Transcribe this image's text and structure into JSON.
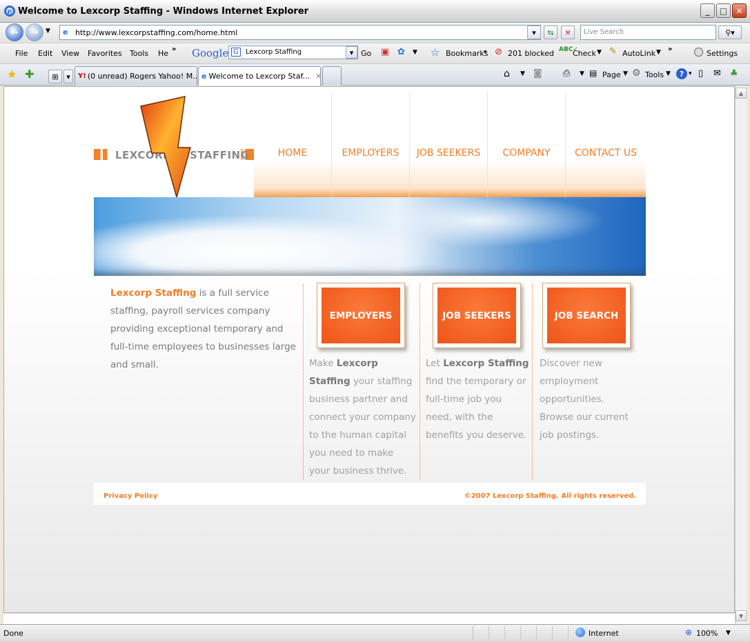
{
  "window": {
    "title": "Welcome to Lexcorp Staffing - Windows Internet Explorer"
  },
  "address": {
    "url": "http://www.lexcorpstaffing.com/home.html",
    "search_placeholder": "Live Search"
  },
  "menu": {
    "items": [
      "File",
      "Edit",
      "View",
      "Favorites",
      "Tools",
      "He"
    ],
    "google_label": "Google",
    "google_query": "Lexcorp Staffing",
    "go_label": "Go",
    "bookmarks": "Bookmarks",
    "blocked": "201 blocked",
    "check": "Check",
    "autolink": "AutoLink",
    "settings": "Settings"
  },
  "tabs": {
    "tab1": "(0 unread) Rogers Yahoo! M...",
    "tab2": "Welcome to Lexcorp Staf..."
  },
  "commands": {
    "page": "Page",
    "tools": "Tools"
  },
  "site": {
    "logo_left": "LEXCORP",
    "logo_right": "STAFFING",
    "nav": [
      "HOME",
      "EMPLOYERS",
      "JOB SEEKERS",
      "COMPANY",
      "CONTACT US"
    ],
    "intro": {
      "brand": "Lexcorp Staffing",
      "text": " is a full service staffing, payroll services company providing exceptional temporary and full-time employees to businesses large and small."
    },
    "cta": [
      "EMPLOYERS",
      "JOB SEEKERS",
      "JOB SEARCH"
    ],
    "col1": {
      "pre": "Make ",
      "brand": "Lexcorp Staffing",
      "post": " your staffing business partner and connect your company to the human capital you need to make your business thrive."
    },
    "col2": {
      "pre": "Let ",
      "brand": "Lexcorp Staffing",
      "post": " find the temporary or full-time job you need, with the benefits you deserve."
    },
    "col3": {
      "text": "Discover new employment opportunities. Browse our current job postings."
    },
    "footer_left": "Privacy Policy",
    "footer_right": "©2007 Lexcorp Staffing. All rights reserved."
  },
  "status": {
    "left": "Done",
    "zone": "Internet",
    "zoom": "100%"
  },
  "colors": {
    "accent": "#f27d25",
    "cta": "#ee5418"
  }
}
